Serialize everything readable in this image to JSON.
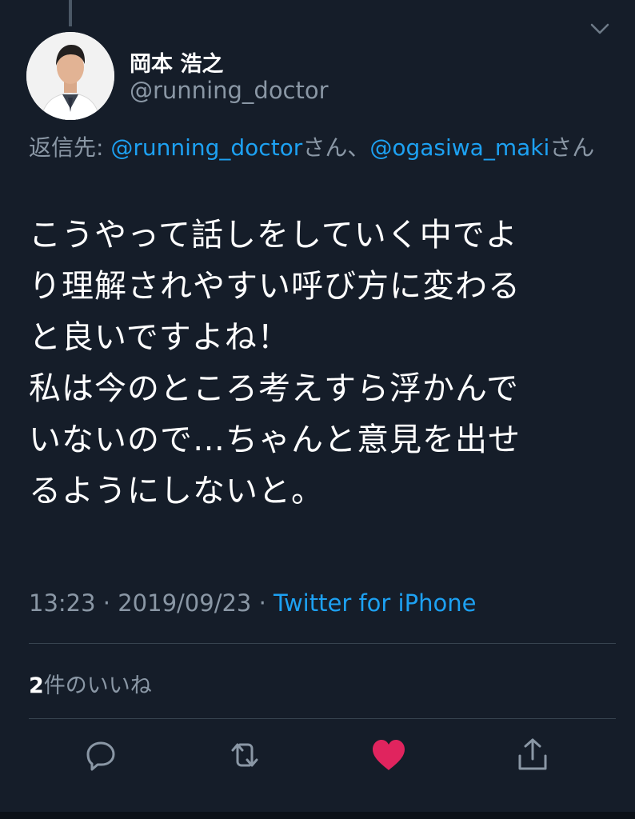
{
  "author": {
    "display_name": "岡本 浩之",
    "handle": "@running_doctor"
  },
  "reply_to": {
    "prefix": "返信先: ",
    "mention1": "@running_doctor",
    "suffix1": "さん、",
    "mention2": "@ogasiwa_maki",
    "suffix2": "さん"
  },
  "tweet": {
    "lines": [
      "こうやって話しをしていく中でよ",
      "り理解されやすい呼び方に変わる",
      "と良いですよね！",
      "私は今のところ考えすら浮かんで",
      "いないので…ちゃんと意見を出せ",
      "るようにしないと。"
    ]
  },
  "meta": {
    "time": "13:23",
    "sep1": " · ",
    "date": "2019/09/23",
    "sep2": " · ",
    "source": "Twitter for iPhone"
  },
  "likes": {
    "count": "2",
    "label": "件のいいね"
  },
  "icons": {
    "caret": "chevron-down-icon",
    "reply": "reply-icon",
    "retweet": "retweet-icon",
    "like": "heart-icon",
    "share": "share-icon"
  },
  "colors": {
    "background": "#151d29",
    "accent": "#1da1f2",
    "like": "#e0245e",
    "muted": "#8a97a5"
  }
}
